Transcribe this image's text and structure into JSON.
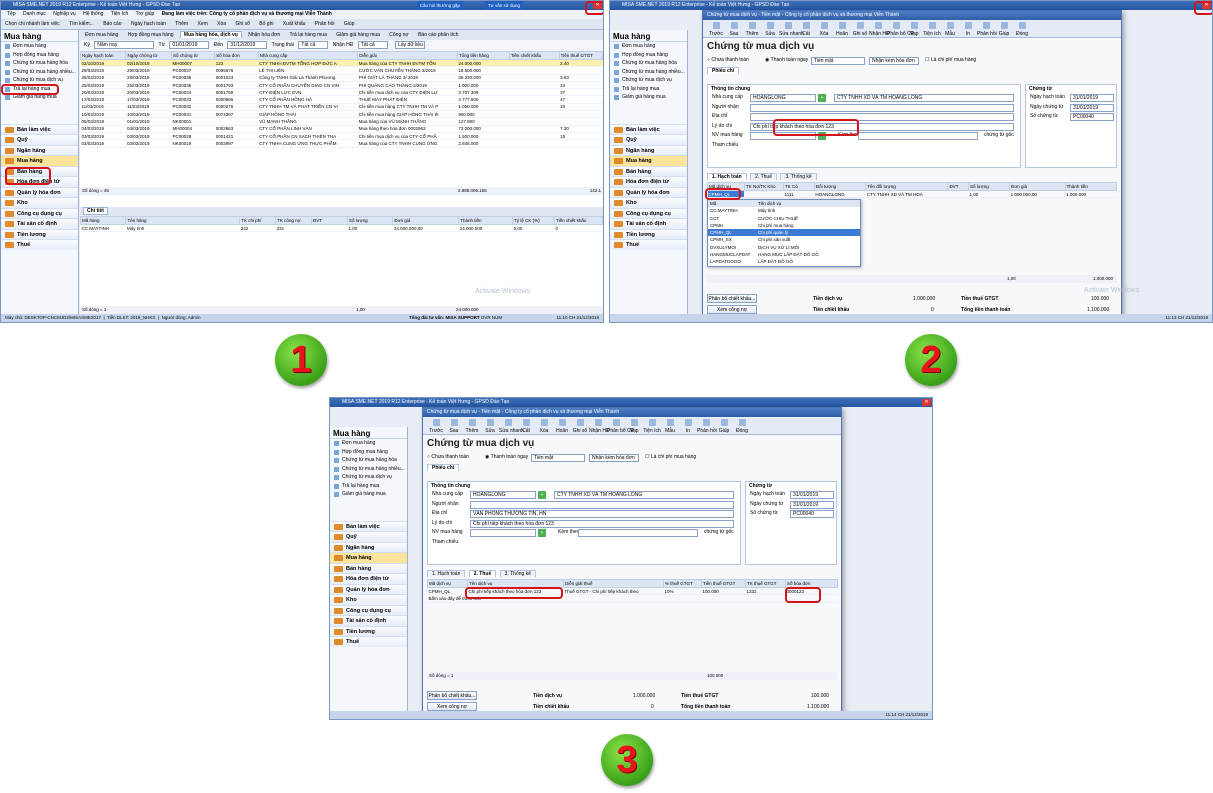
{
  "s1": {
    "title": "MISA SME.NET 2019 R12 Enterprise - Kế toán Việt Hưng - GPSD Đào Tạo",
    "badge1": "Câu hỏi thường gặp",
    "badge2": "Tư vấn sử dụng",
    "menu": [
      "Tệp",
      "Danh mục",
      "Nghiệp vụ",
      "Hệ thống",
      "Tiện ích",
      "Trợ giúp"
    ],
    "menu_working": "Đang làm việc trên: Công ty cổ phần dịch vụ và thương mại Viễn Thành",
    "toolbar": [
      "Chọn chi nhánh làm việc",
      "Tìm kiếm...",
      "Báo cáo",
      "Ngày hạch toán",
      "Thêm",
      "Xem",
      "Xóa",
      "Ghi sổ",
      "Bỏ ghi",
      "Xuất khẩu",
      "Phản hồi",
      "Giúp"
    ],
    "side_title": "Mua hàng",
    "side_links": [
      "Đơn mua hàng",
      "Hợp đồng mua hàng",
      "Chứng từ mua hàng hóa",
      "Chứng từ mua hàng nhiều...",
      "Chứng từ mua dịch vụ",
      "Trả lại hàng mua",
      "Giảm giá hàng mua"
    ],
    "modules": [
      "Bán làm việc",
      "Quỹ",
      "Ngân hàng",
      "Mua hàng",
      "Bán hàng",
      "Hóa đơn điện tử",
      "Quản lý hóa đơn",
      "Kho",
      "Công cụ dụng cụ",
      "Tài sản cố định",
      "Tiền lương",
      "Thuế"
    ],
    "tabs": [
      "Đơn mua hàng",
      "Hợp đồng mua hàng",
      "Mua hàng hóa, dịch vụ",
      "Nhận hóa đơn",
      "Trả lại hàng mua",
      "Giảm giá hàng mua",
      "Công nợ",
      "Báo cáo phân tích"
    ],
    "filter": {
      "ky_label": "Kỳ",
      "ky": "Năm nay",
      "tu_label": "Từ",
      "tu": "01/01/2019",
      "den_label": "Đến",
      "den": "31/12/2019",
      "tt_label": "Trạng thái",
      "tt": "Tất cả",
      "nhd_label": "Nhận HĐ",
      "nhd": "Tất cả",
      "btn": "Lấy dữ liệu"
    },
    "columns": [
      "Ngày hạch toán",
      "Ngày chứng từ",
      "Số chứng từ",
      "Số hóa đơn",
      "Nhà cung cấp",
      "Diễn giải",
      "Tổng tiền hàng",
      "Tiền chiết khấu",
      "Tiền thuế GTGT"
    ],
    "rows": [
      [
        "02/10/2019",
        "02/10/2019",
        "MH00007",
        "123",
        "CTY TNHH ĐVTM TỔNG HỢP ĐỨC A",
        "Mua hàng của CTY TNHH ĐVTM TỔN",
        "24.000.000",
        "",
        "2.40"
      ],
      [
        "29/03/2019",
        "29/03/2019",
        "PC00037",
        "0095678",
        "LÊ THỊ LIÊN",
        "CƯỚC VẬN CHUYỂN THÁNG 3/2019",
        "18.500.000",
        "",
        ""
      ],
      [
        "28/03/2019",
        "28/03/2019",
        "PC00036",
        "0001023",
        "Công ty TNHH Giải Lá Thành Phương",
        "PHÍ GIẶT LÀ THÁNG 3/ 2019",
        "36.320.000",
        "",
        "3.63"
      ],
      [
        "25/03/2019",
        "25/03/2019",
        "PC00035",
        "0001793",
        "CTY CỔ PHẦN CHUYỂN GIAO CN VIN",
        "PHÍ QUẢNG CÁO THÁNG 2/2019",
        "1.000.000",
        "",
        "10"
      ],
      [
        "20/03/2019",
        "20/03/2019",
        "PC00034",
        "0001769",
        "CTY ĐIỆN LỰC EVN",
        "Chi tiền mua dịch vụ của CTY ĐIỆN LỰ",
        "3.707.309",
        "",
        "37"
      ],
      [
        "17/03/2019",
        "17/03/2019",
        "PC00033",
        "0000866",
        "CTY CỔ PHẦN HỒNG HÀ",
        "THUÊ MÁY PHÁT ĐIỆN",
        "4.777.600",
        "",
        "47"
      ],
      [
        "11/03/2019",
        "11/03/2019",
        "PC00032",
        "0000276",
        "CTY TNHH TM VÀ PHÁT TRIỂN CN VI",
        "Chi tiền mua hàng CTY TNHH TM VÀ P",
        "1.050.000",
        "",
        "10"
      ],
      [
        "10/03/2019",
        "10/03/2019",
        "PC00031",
        "0074367",
        "GIÁP HỒNG THÁI",
        "Chi tiền mua hàng GIÁP HỒNG THÁI th",
        "900.000",
        "",
        ""
      ],
      [
        "05/03/2019",
        "01/01/2019",
        "NK00001",
        "",
        "VŨ MẠNH THẮNG",
        "Mua hàng của VŨ MẠNH THẮNG",
        "127.800",
        "",
        ""
      ],
      [
        "04/03/2019",
        "04/03/2019",
        "MH00004",
        "0002963",
        "CTY CỔ PHẦN LINH VÂN",
        "Mua hàng theo hóa đơn 0002963",
        "73.000.000",
        "",
        "7.30"
      ],
      [
        "03/03/2019",
        "03/03/2019",
        "PC00029",
        "0001421",
        "CTY CỔ PHẦN CN SẠCH THIÊN THA",
        "Chi tiền mua dịch vụ của CTY CỔ PHẦ",
        "1.500.000",
        "",
        "15"
      ],
      [
        "03/03/2019",
        "03/03/2019",
        "NK00019",
        "0002997",
        "CTY TNHH CUNG ỨNG THỰC PHẨM",
        "Mua hàng của CTY TNHH CUNG ỨNG",
        "2.845.000",
        "",
        ""
      ]
    ],
    "sum_label": "Số dòng = 45",
    "sum_total": "2.888.006.155",
    "sum_tax": "142.1",
    "detail_tab": "Chi tiết",
    "detail_columns": [
      "Mã hàng",
      "Tên hàng",
      "TK chi phí",
      "TK công nợ",
      "ĐVT",
      "Số lượng",
      "Đơn giá",
      "Thành tiền",
      "Tỷ lệ CK (%)",
      "Tiền chiết khấu"
    ],
    "detail_row": [
      "CC.MAYTINH",
      "Máy tính",
      "242",
      "331",
      "",
      "1,00",
      "24.000.000,00",
      "24.000.000",
      "0,00",
      "0"
    ],
    "detail_sum": "Số dòng = 1",
    "detail_sum_qty": "1,00",
    "detail_sum_total": "24.000.000",
    "status": [
      "Máy chủ: DESKTOP-CNCMJD2\\MISASME2017",
      "Tiền DLKT: 2019_NHKS",
      "Người dùng: Admin",
      "Tổng đài tư vấn:",
      "MISA SUPPORT",
      "OVR",
      "NUM",
      "11:10 CH",
      "21/12/2019"
    ],
    "watermark": "Activate Windows"
  },
  "s2": {
    "title": "MISA SME.NET 2019 R12 Enterprise - Kế toán Việt Hưng - GPSD Đào Tạo",
    "dlg_title": "Chứng từ mua dịch vụ - Tiền mặt - Công ty cổ phần dịch vụ và thương mại Viễn Thành",
    "dtool": [
      "Trước",
      "Sau",
      "Thêm",
      "Sửa",
      "Sửa nhanh",
      "Cất",
      "Xóa",
      "Hoãn",
      "Ghi sổ",
      "Nhận HĐ",
      "Phân bổ CP",
      "Nạp",
      "Tiện ích",
      "Mẫu",
      "In",
      "Phản hồi",
      "Giúp",
      "Đóng"
    ],
    "heading": "Chứng từ mua dịch vụ",
    "opt_unpaid": "Chưa thanh toán",
    "opt_paid": "Thanh toán ngay",
    "pay_method": "Tiền mặt",
    "inv_opt": "Nhận kèm hóa đơn",
    "cp_ptrl": "Là chi phí mua hàng",
    "tab_phieuchi": "Phiếu chi",
    "grp_general": "Thông tin chung",
    "grp_voucher": "Chứng từ",
    "f_ncc": "Nhà cung cấp",
    "ncc_code": "HOANGLONG",
    "ncc_name": "CTY TNHH XD VÀ TM HOÀNG LONG",
    "f_nguoinhan": "Người nhận",
    "nguoinhan": "",
    "f_diachi": "Địa chỉ",
    "diachi": "",
    "f_lydo": "Lý do chi",
    "lydo": "Chi phí tiếp khách theo hóa đơn 123",
    "f_nvmh": "NV mua hàng",
    "kemtheo": "Kèm theo",
    "ctgoc": "chứng từ gốc",
    "f_thamchieu": "Tham chiếu",
    "f_ngayht": "Ngày hạch toán",
    "ngayht": "31/01/2019",
    "f_ngayct": "Ngày chứng từ",
    "ngayct": "31/01/2019",
    "f_soct": "Số chứng từ",
    "soct": "PC00040",
    "dtabs": [
      "1. Hạch toán",
      "2. Thuế",
      "3. Thống kê"
    ],
    "dcols": [
      "Mã dịch vụ",
      "TK Nợ/TK Kho",
      "TK Có",
      "Đối tượng",
      "Tên đối tượng",
      "ĐVT",
      "Số lượng",
      "Đơn giá",
      "Thành tiền"
    ],
    "drow": [
      "CPMH_QL",
      "",
      "1111",
      "HOANGLONG",
      "CTY TNHH XD VÀ TM HOÀ",
      "",
      "1,00",
      "1.000.000,00",
      "1.000.000"
    ],
    "dd_header": [
      "Mã",
      "Tên dịch vụ"
    ],
    "dd_rows": [
      [
        "CC.MAYTINH",
        "Máy tính"
      ],
      [
        "CCT",
        "CƯỚC CHIU THUẾ"
      ],
      [
        "CPMH",
        "Chi phí mua hàng"
      ],
      [
        "CPMH_QL",
        "Chi phí quản lý"
      ],
      [
        "CPMH_SX",
        "Chi phí sản xuất"
      ],
      [
        "DVXULYMOI",
        "DỊCH VỤ XỬ LÍ MỐI"
      ],
      [
        "HANGMUCLAPDAT",
        "HẠNG MỤC LẮP ĐẶT ĐỒ GỖ"
      ],
      [
        "LAPDATDOGO",
        "LẮP ĐẶT ĐỒ GỖ"
      ]
    ],
    "sum_qty": "1,00",
    "sum_total": "1.000.000",
    "btn_pb": "Phân bổ chiết khấu...",
    "btn_cn": "Xem công nợ",
    "foot_tdv": "Tiền dịch vụ",
    "foot_tdv_v": "1.000.000",
    "foot_thue": "Tiền thuế GTGT",
    "foot_thue_v": "100.000",
    "foot_ck": "Tiền chiết khấu",
    "foot_ck_v": "0",
    "foot_tong": "Tổng tiền thanh toán",
    "foot_tong_v": "1.100.000",
    "status_time": "11:13 CH",
    "status_date": "21/12/2019",
    "watermark": "Activate Windows"
  },
  "s3": {
    "title": "MISA SME.NET 2019 R12 Enterprise - Kế toán Việt Hưng - GPSD Đào Tạo",
    "dlg_title": "Chứng từ mua dịch vụ - Tiền mặt - Công ty cổ phần dịch vụ và thương mại Viễn Thành",
    "heading": "Chứng từ mua dịch vụ",
    "nguoinhan": "",
    "diachi": "VĂN PHÒNG THƯƠNG TÍN, HN",
    "lydo": "Chi phí tiếp khách theo hóa đơn 123",
    "tcols": [
      "Mã dịch vụ",
      "Tên dịch vụ",
      "Diễn giải thuế",
      "% thuế GTGT",
      "Tiền thuế GTGT",
      "TK thuế GTGT",
      "Số hóa đơn"
    ],
    "trow": [
      "CPMH_QL",
      "Chi phí tiếp khách theo hóa đơn 123",
      "Thuế GTGT - Chi phí tiếp khách theo",
      "10%",
      "100.000",
      "1331",
      "0000123"
    ],
    "trow2": "Bấm vào đây để thêm mới",
    "sum_label": "Số dòng = 1",
    "sum_tax": "100.000",
    "status_time": "11:14 CH",
    "status_date": "21/12/2019"
  },
  "markers": [
    "1",
    "2",
    "3"
  ]
}
